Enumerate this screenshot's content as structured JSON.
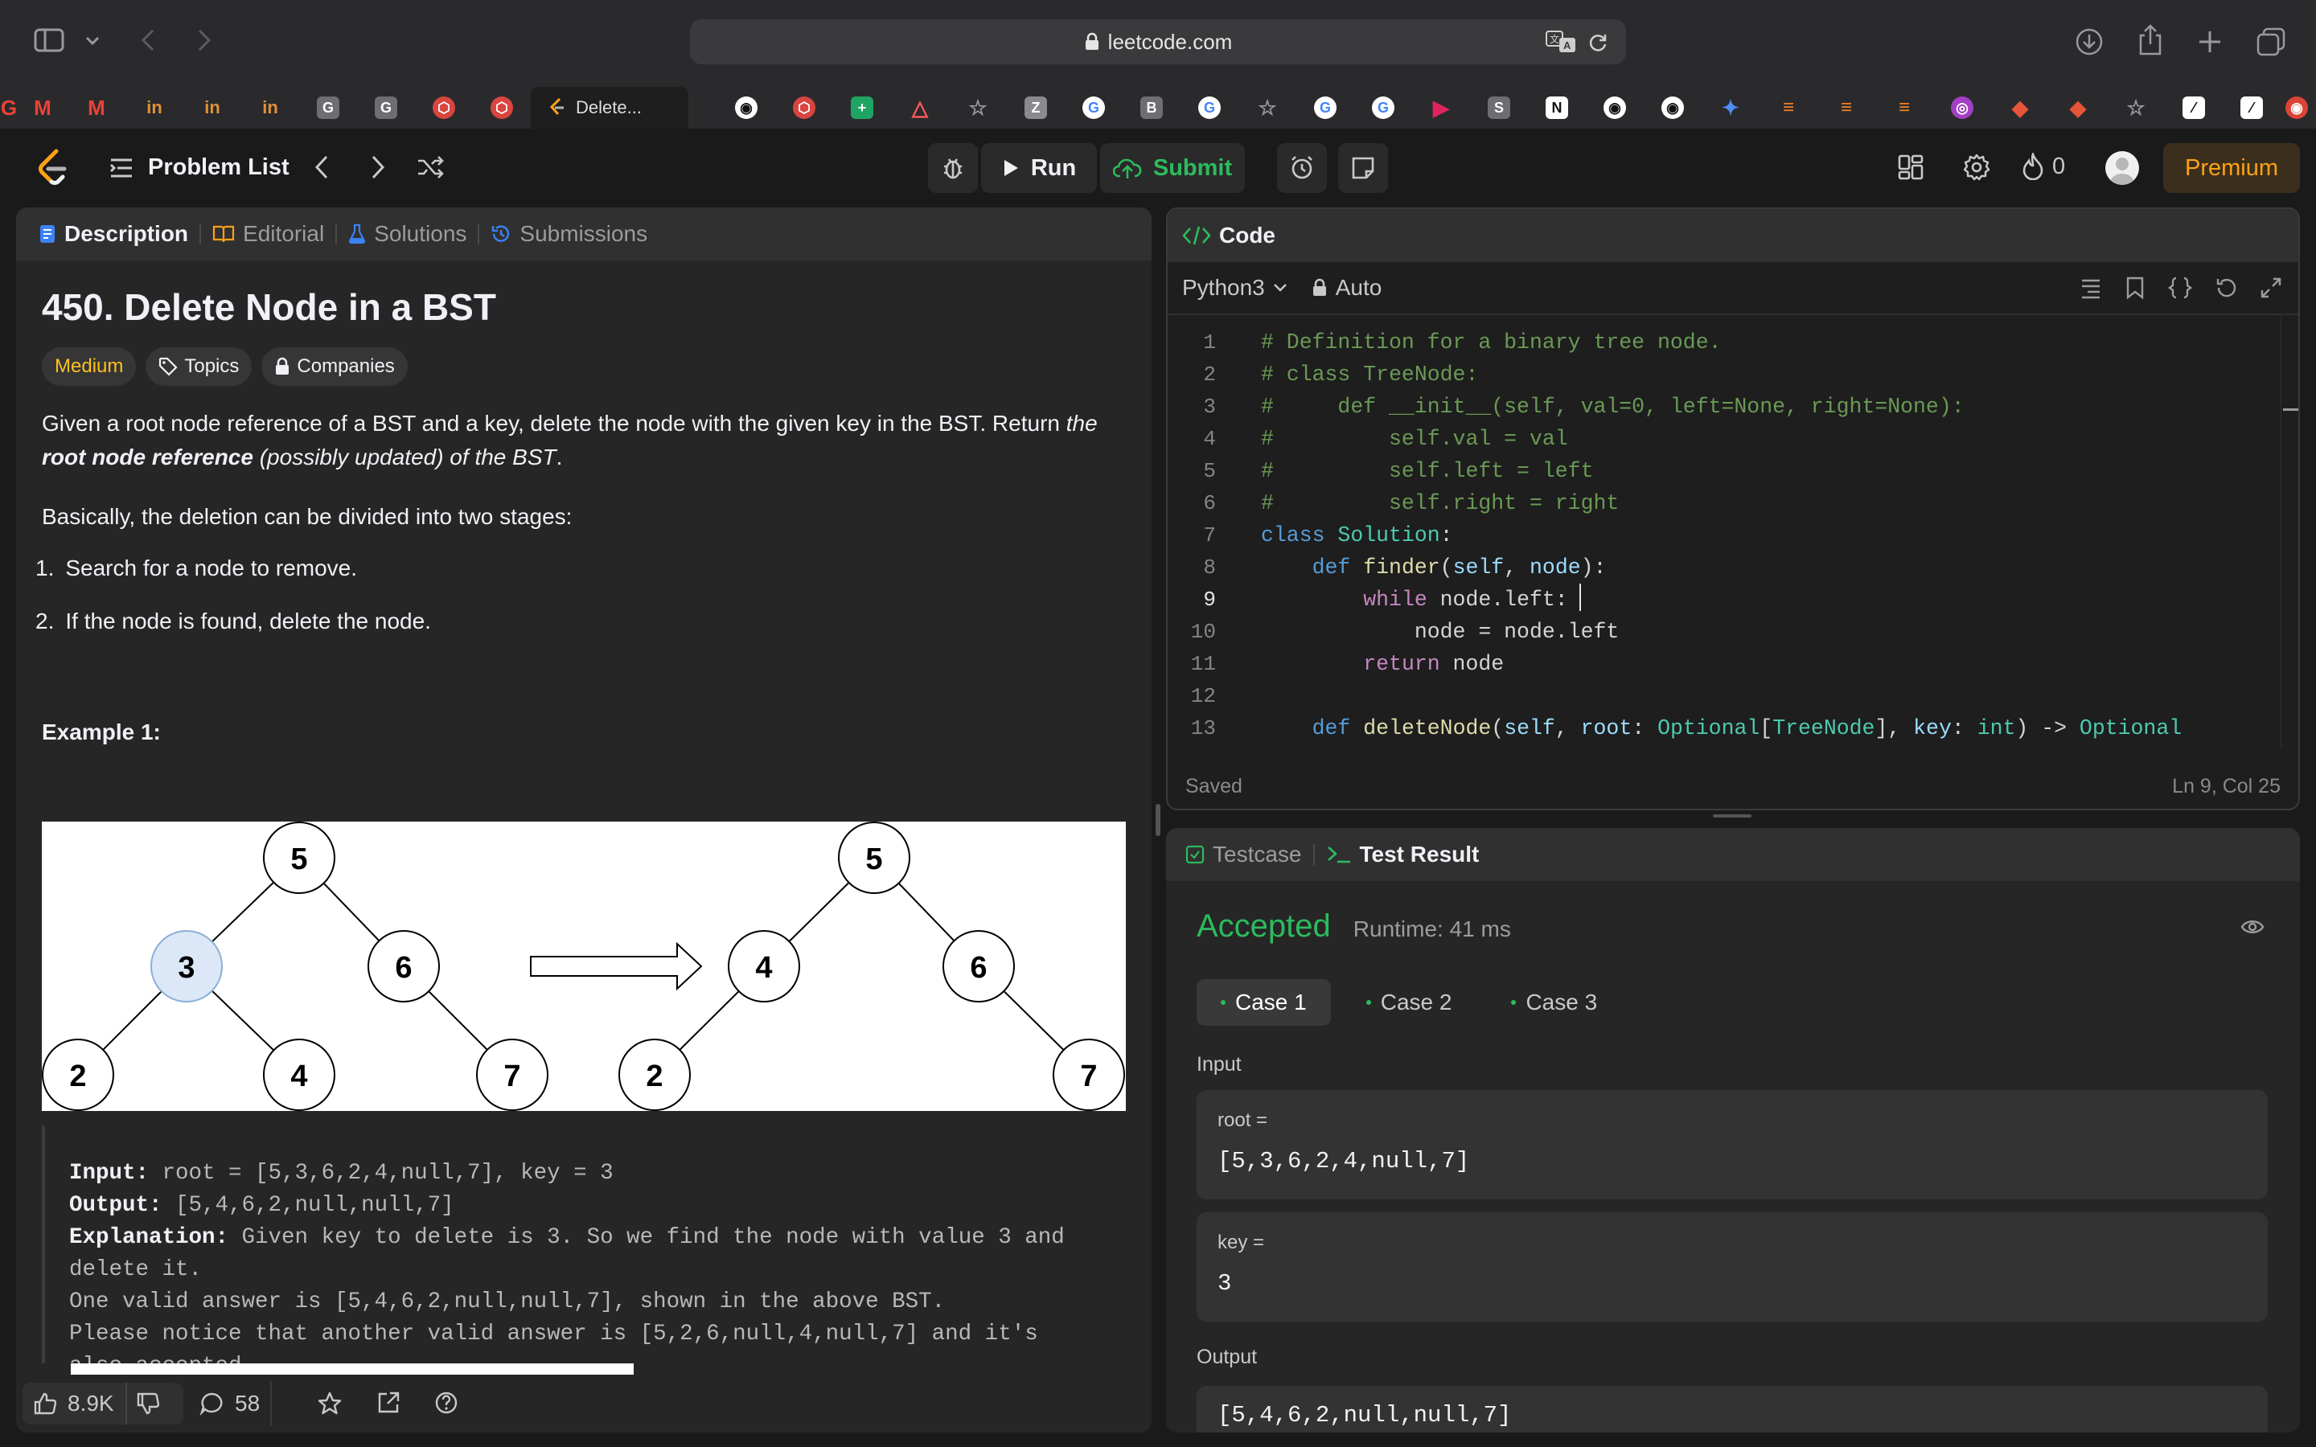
{
  "browser": {
    "url": "leetcode.com",
    "active_tab": "Delete...",
    "colors": {
      "chrome_bg": "#2a2a2c",
      "url_bg": "#3a3a3c"
    }
  },
  "nav": {
    "problem_list": "Problem List",
    "run": "Run",
    "submit": "Submit",
    "streak": "0",
    "premium": "Premium"
  },
  "description": {
    "tabs": [
      "Description",
      "Editorial",
      "Solutions",
      "Submissions"
    ],
    "title": "450. Delete Node in a BST",
    "difficulty": "Medium",
    "topics": "Topics",
    "companies": "Companies",
    "para1_a": "Given a root node reference of a BST and a key, delete the node with the given key in the BST. Return ",
    "para1_b": "the ",
    "para1_c": "root node reference",
    "para1_d": " (possibly updated) of the BST",
    "para1_e": ".",
    "para2": "Basically, the deletion can be divided into two stages:",
    "steps": [
      "Search for a node to remove.",
      "If the node is found, delete the node."
    ],
    "step_nums": [
      "1.",
      "2."
    ],
    "example_title": "Example 1:",
    "tree_before": [
      "5",
      "3",
      "6",
      "2",
      "4",
      "7"
    ],
    "tree_after": [
      "5",
      "4",
      "6",
      "2",
      "7"
    ],
    "input_label": "Input:",
    "input_value": " root = [5,3,6,2,4,null,7], key = 3",
    "output_label": "Output:",
    "output_value": " [5,4,6,2,null,null,7]",
    "explanation_label": "Explanation:",
    "explanation_value": " Given key to delete is 3. So we find the node with value 3 and",
    "explanation_line2": "delete it.",
    "explanation_line3": "One valid answer is [5,4,6,2,null,null,7], shown in the above BST.",
    "explanation_line4": "Please notice that another valid answer is [5,2,6,null,4,null,7] and it's",
    "explanation_line5": "also accepted.",
    "likes": "8.9K",
    "comments": "58"
  },
  "code": {
    "title": "Code",
    "language": "Python3",
    "autocomplete": "Auto",
    "status": "Saved",
    "cursor": "Ln 9, Col 25",
    "line_numbers": [
      "1",
      "2",
      "3",
      "4",
      "5",
      "6",
      "7",
      "8",
      "9",
      "10",
      "11",
      "12",
      "13"
    ],
    "lines": [
      "# Definition for a binary tree node.",
      "# class TreeNode:",
      "#     def __init__(self, val=0, left=None, right=None):",
      "#         self.val = val",
      "#         self.left = left",
      "#         self.right = right",
      "class Solution:",
      "    def finder(self, node):",
      "        while node.left:",
      "            node = node.left",
      "        return node",
      "",
      "    def deleteNode(self, root: Optional[TreeNode], key: int) -> Optional"
    ]
  },
  "result": {
    "tabs": [
      "Testcase",
      "Test Result"
    ],
    "verdict": "Accepted",
    "runtime": "Runtime: 41 ms",
    "cases": [
      "Case 1",
      "Case 2",
      "Case 3"
    ],
    "input_label": "Input",
    "root_label": "root =",
    "root_value": "[5,3,6,2,4,null,7]",
    "key_label": "key =",
    "key_value": "3",
    "output_label": "Output",
    "output_value": "[5,4,6,2,null,null,7]",
    "colors": {
      "accepted": "#2cbb5d",
      "premium": "#ffa116",
      "medium": "#ffc01e"
    }
  }
}
